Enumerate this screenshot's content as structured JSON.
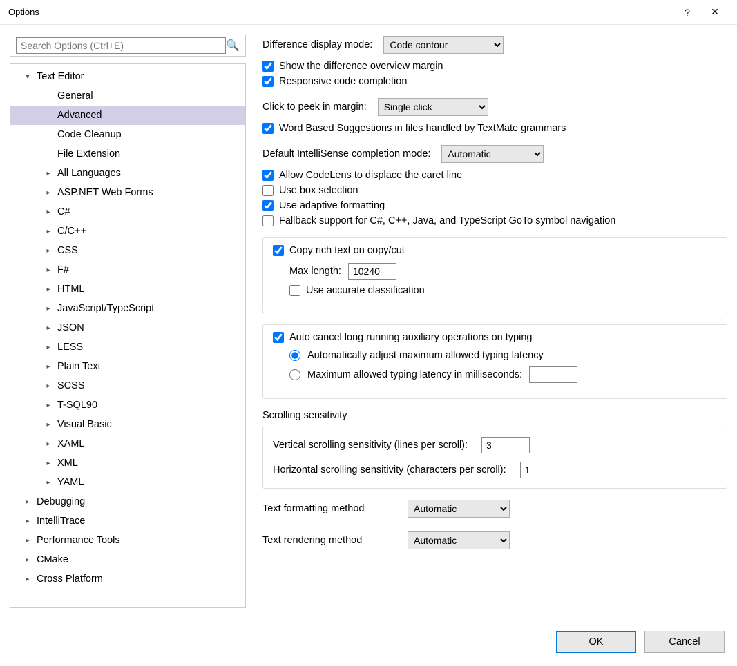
{
  "window": {
    "title": "Options"
  },
  "search": {
    "placeholder": "Search Options (Ctrl+E)"
  },
  "tree": [
    {
      "label": "Text Editor",
      "level": 0,
      "expander": "▾",
      "selected": false
    },
    {
      "label": "General",
      "level": 1,
      "expander": "",
      "selected": false
    },
    {
      "label": "Advanced",
      "level": 1,
      "expander": "",
      "selected": true
    },
    {
      "label": "Code Cleanup",
      "level": 1,
      "expander": "",
      "selected": false
    },
    {
      "label": "File Extension",
      "level": 1,
      "expander": "",
      "selected": false
    },
    {
      "label": "All Languages",
      "level": 1,
      "expander": "▸",
      "selected": false
    },
    {
      "label": "ASP.NET Web Forms",
      "level": 1,
      "expander": "▸",
      "selected": false
    },
    {
      "label": "C#",
      "level": 1,
      "expander": "▸",
      "selected": false
    },
    {
      "label": "C/C++",
      "level": 1,
      "expander": "▸",
      "selected": false
    },
    {
      "label": "CSS",
      "level": 1,
      "expander": "▸",
      "selected": false
    },
    {
      "label": "F#",
      "level": 1,
      "expander": "▸",
      "selected": false
    },
    {
      "label": "HTML",
      "level": 1,
      "expander": "▸",
      "selected": false
    },
    {
      "label": "JavaScript/TypeScript",
      "level": 1,
      "expander": "▸",
      "selected": false
    },
    {
      "label": "JSON",
      "level": 1,
      "expander": "▸",
      "selected": false
    },
    {
      "label": "LESS",
      "level": 1,
      "expander": "▸",
      "selected": false
    },
    {
      "label": "Plain Text",
      "level": 1,
      "expander": "▸",
      "selected": false
    },
    {
      "label": "SCSS",
      "level": 1,
      "expander": "▸",
      "selected": false
    },
    {
      "label": "T-SQL90",
      "level": 1,
      "expander": "▸",
      "selected": false
    },
    {
      "label": "Visual Basic",
      "level": 1,
      "expander": "▸",
      "selected": false
    },
    {
      "label": "XAML",
      "level": 1,
      "expander": "▸",
      "selected": false
    },
    {
      "label": "XML",
      "level": 1,
      "expander": "▸",
      "selected": false
    },
    {
      "label": "YAML",
      "level": 1,
      "expander": "▸",
      "selected": false
    },
    {
      "label": "Debugging",
      "level": 0,
      "expander": "▸",
      "selected": false
    },
    {
      "label": "IntelliTrace",
      "level": 0,
      "expander": "▸",
      "selected": false
    },
    {
      "label": "Performance Tools",
      "level": 0,
      "expander": "▸",
      "selected": false
    },
    {
      "label": "CMake",
      "level": 0,
      "expander": "▸",
      "selected": false
    },
    {
      "label": "Cross Platform",
      "level": 0,
      "expander": "▸",
      "selected": false
    }
  ],
  "settings": {
    "diff_mode_label": "Difference display mode:",
    "diff_mode_value": "Code contour",
    "show_diff_margin": "Show the difference overview margin",
    "responsive_completion": "Responsive code completion",
    "click_peek_label": "Click to peek in margin:",
    "click_peek_value": "Single click",
    "word_based": "Word Based Suggestions in files handled by TextMate grammars",
    "intellisense_label": "Default IntelliSense completion mode:",
    "intellisense_value": "Automatic",
    "codelens": "Allow CodeLens to displace the caret line",
    "box_selection": "Use box selection",
    "adaptive_formatting": "Use adaptive formatting",
    "fallback": "Fallback support for C#, C++, Java, and TypeScript GoTo symbol navigation",
    "copy_rich": "Copy rich text on copy/cut",
    "max_length_label": "Max length:",
    "max_length_value": "10240",
    "accurate_classification": "Use accurate classification",
    "auto_cancel": "Auto cancel long running auxiliary operations on typing",
    "radio_auto": "Automatically adjust maximum allowed typing latency",
    "radio_max": "Maximum allowed typing latency in milliseconds:",
    "radio_max_value": "",
    "scroll_title": "Scrolling sensitivity",
    "vert_scroll_label": "Vertical scrolling sensitivity (lines per scroll):",
    "vert_scroll_value": "3",
    "horz_scroll_label": "Horizontal scrolling sensitivity (characters per scroll):",
    "horz_scroll_value": "1",
    "text_format_label": "Text formatting method",
    "text_format_value": "Automatic",
    "text_render_label": "Text rendering method",
    "text_render_value": "Automatic"
  },
  "buttons": {
    "ok": "OK",
    "cancel": "Cancel"
  }
}
